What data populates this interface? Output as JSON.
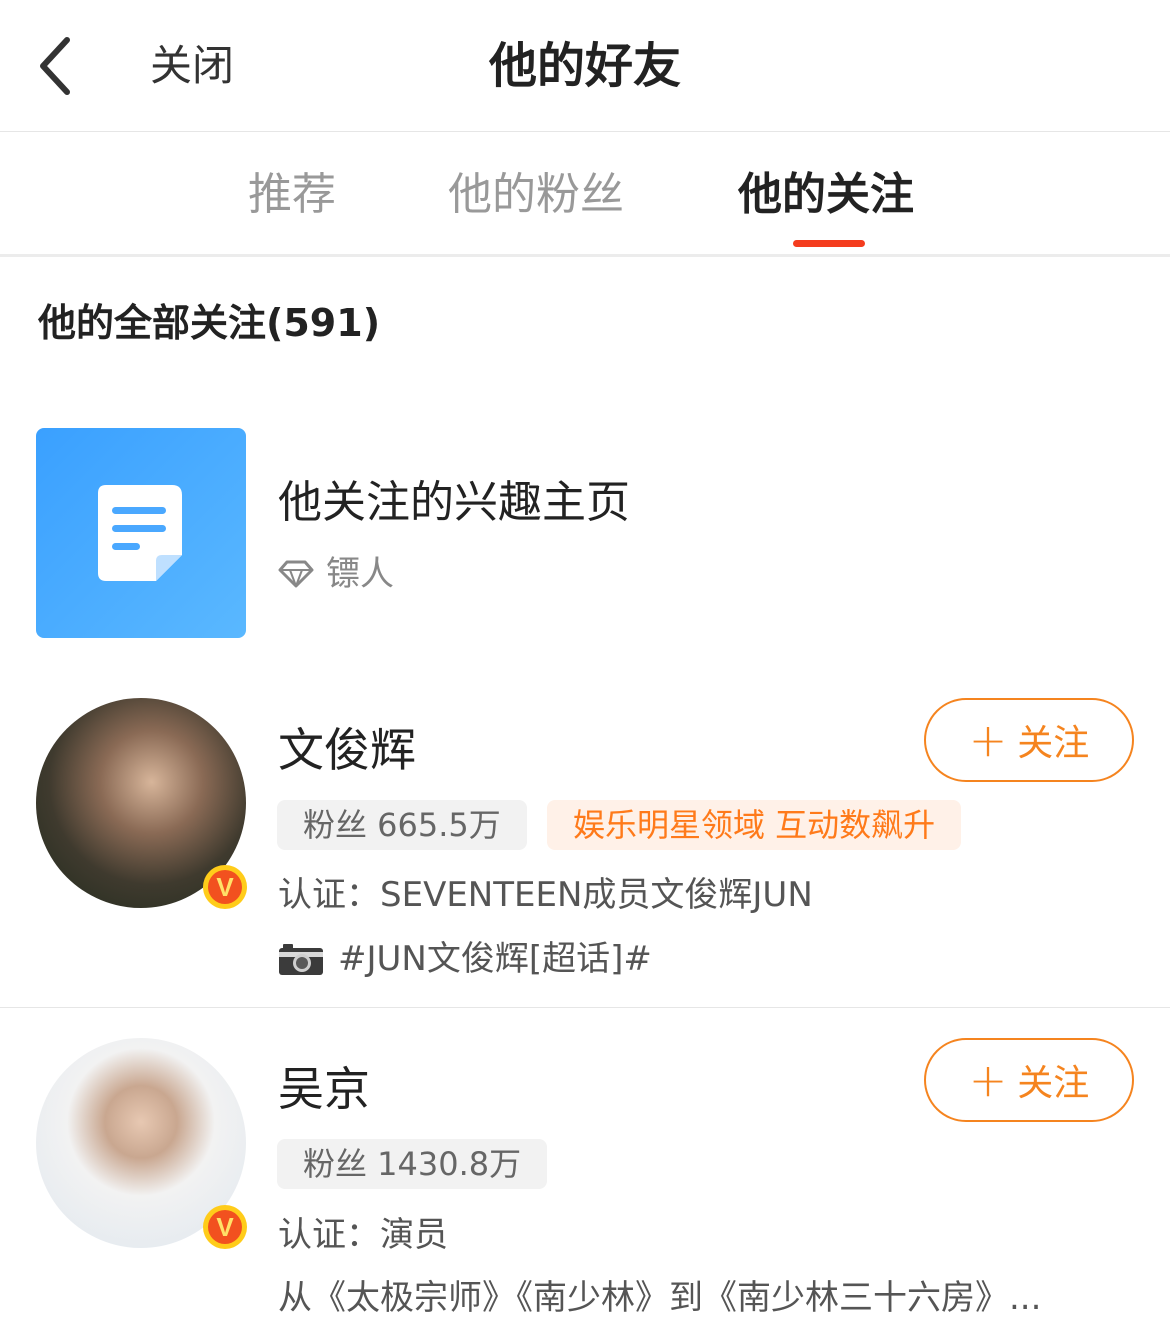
{
  "nav": {
    "back_icon": "chevron-left-icon",
    "close_label": "关闭",
    "title": "他的好友"
  },
  "tabs": [
    {
      "label": "推荐",
      "active": false
    },
    {
      "label": "他的粉丝",
      "active": false
    },
    {
      "label": "他的关注",
      "active": true
    }
  ],
  "colors": {
    "accent": "#f43c1e",
    "follow": "#f5841f",
    "interest_tile": "#4aa8ff"
  },
  "section": {
    "title": "他的全部关注(591)"
  },
  "interest": {
    "title": "他关注的兴趣主页",
    "tag_icon": "diamond-icon",
    "tag_label": "镖人"
  },
  "users": [
    {
      "name": "文俊辉",
      "follow_label": "关注",
      "fans": "粉丝 665.5万",
      "highlight": "娱乐明星领域 互动数飙升",
      "verify": "认证：SEVENTEEN成员文俊辉JUN",
      "topic_icon": "camera-icon",
      "topic": "#JUN文俊辉[超话]#"
    },
    {
      "name": "吴京",
      "follow_label": "关注",
      "fans": "粉丝 1430.8万",
      "verify": "认证：演员",
      "desc": "从《太极宗师》《南少林》到《南少林三十六房》..."
    }
  ]
}
